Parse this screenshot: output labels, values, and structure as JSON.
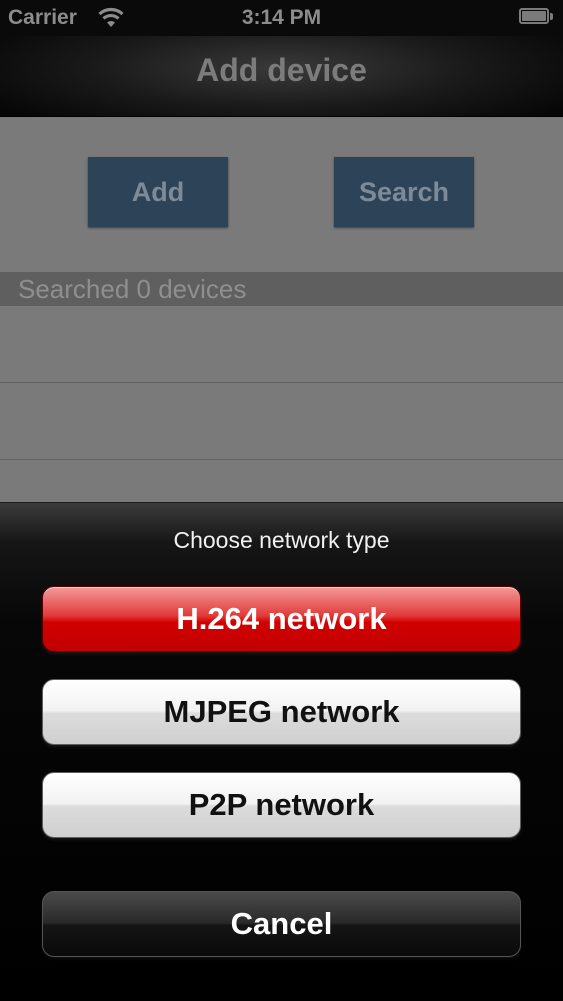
{
  "status_bar": {
    "carrier": "Carrier",
    "time": "3:14 PM",
    "wifi_icon": "wifi-icon",
    "battery_icon": "battery-icon"
  },
  "nav_bar": {
    "title": "Add device"
  },
  "main": {
    "add_label": "Add",
    "search_label": "Search",
    "section_header": "Searched 0 devices",
    "button_color": "#2c4358"
  },
  "action_sheet": {
    "title": "Choose network type",
    "options": [
      {
        "label": "H.264 network",
        "color": "#d20000"
      },
      {
        "label": "MJPEG network"
      },
      {
        "label": "P2P network"
      }
    ],
    "cancel_label": "Cancel"
  }
}
